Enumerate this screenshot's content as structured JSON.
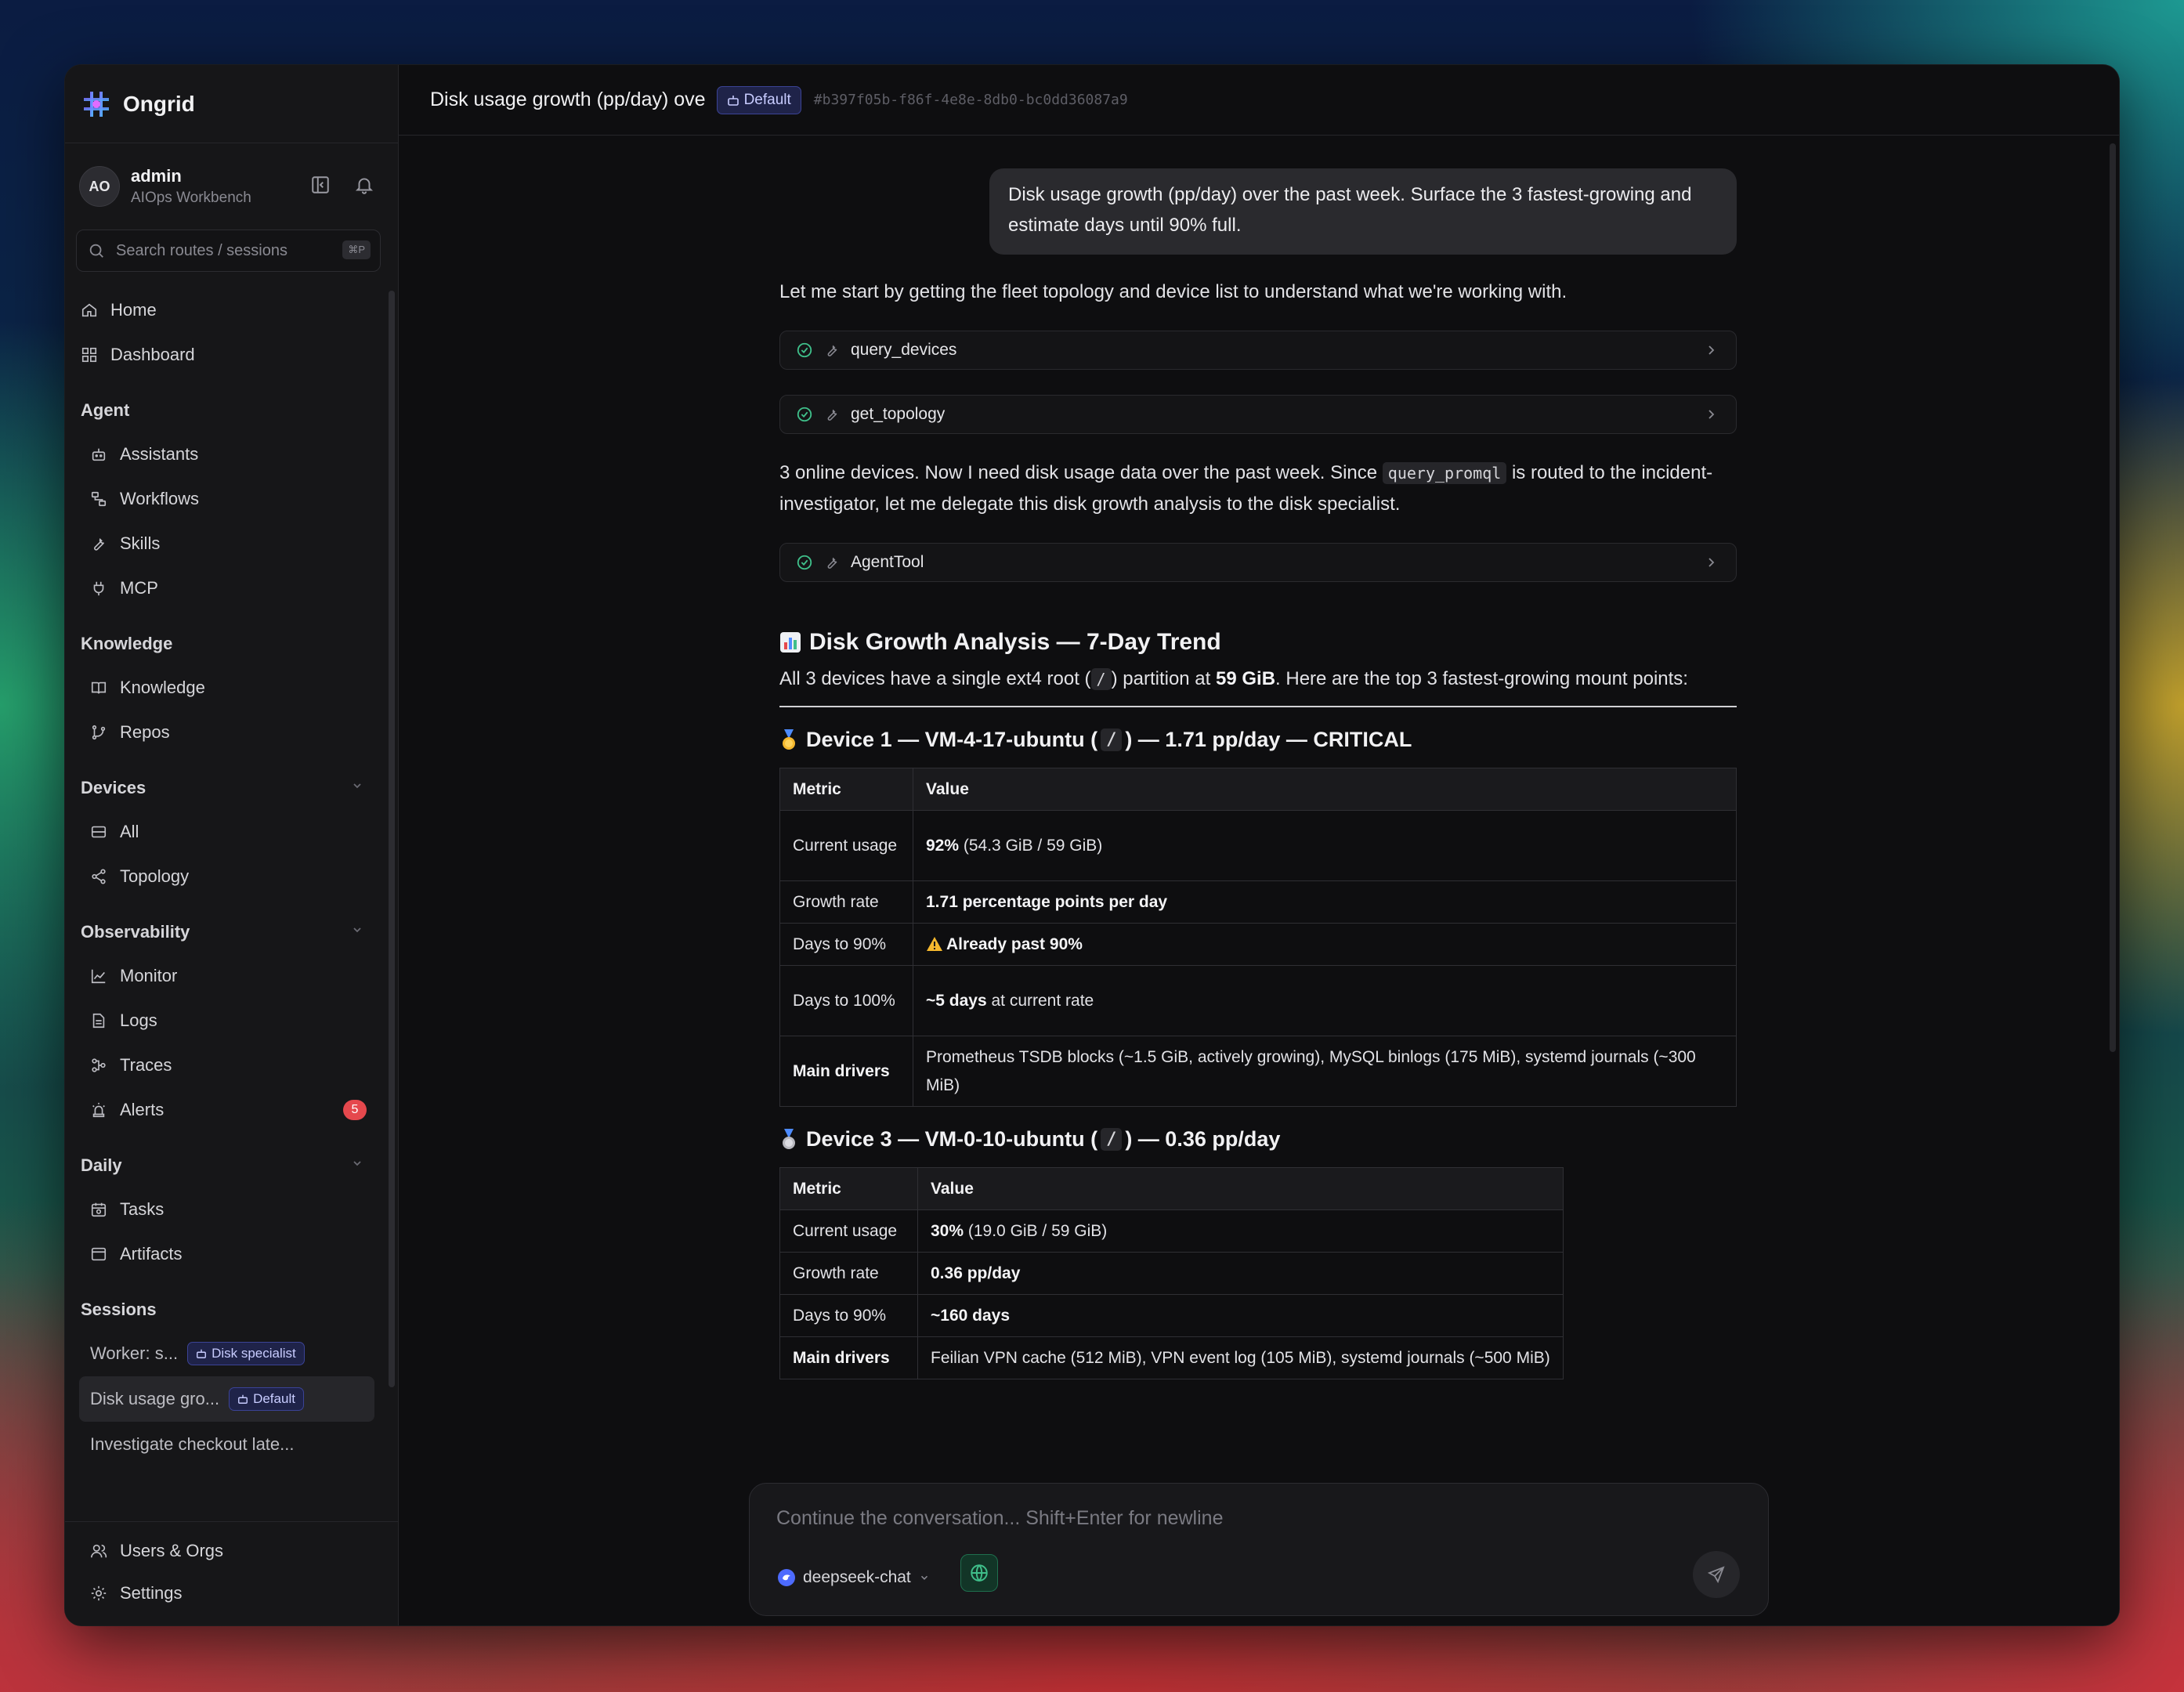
{
  "app": {
    "name": "Ongrid"
  },
  "user": {
    "initials": "AO",
    "name": "admin",
    "subtitle": "AIOps Workbench"
  },
  "search": {
    "placeholder": "Search routes / sessions",
    "shortcut": "⌘P"
  },
  "nav": {
    "home": "Home",
    "dashboard": "Dashboard",
    "agent_title": "Agent",
    "assistants": "Assistants",
    "workflows": "Workflows",
    "skills": "Skills",
    "mcp": "MCP",
    "knowledge_title": "Knowledge",
    "knowledge": "Knowledge",
    "repos": "Repos",
    "devices_title": "Devices",
    "all": "All",
    "topology": "Topology",
    "observability_title": "Observability",
    "monitor": "Monitor",
    "logs": "Logs",
    "traces": "Traces",
    "alerts": "Alerts",
    "alerts_count": "5",
    "daily_title": "Daily",
    "tasks": "Tasks",
    "artifacts": "Artifacts",
    "sessions_title": "Sessions",
    "users_orgs": "Users & Orgs",
    "settings": "Settings"
  },
  "sessions": [
    {
      "label": "Worker: s...",
      "tag": "Disk specialist"
    },
    {
      "label": "Disk usage gro...",
      "tag": "Default"
    },
    {
      "label": "Investigate checkout late..."
    }
  ],
  "header": {
    "title": "Disk usage growth (pp/day) ove",
    "tag": "Default",
    "hash": "#b397f05b-f86f-4e8e-8db0-bc0dd36087a9"
  },
  "chat": {
    "user_message": "Disk usage growth (pp/day) over the past week. Surface the 3 fastest-growing and estimate days until 90% full.",
    "intro": "Let me start by getting the fleet topology and device list to understand what we're working with.",
    "tool1": "query_devices",
    "tool2": "get_topology",
    "mid_a": "3 online devices. Now I need disk usage data over the past week. Since ",
    "mid_code": "query_promql",
    "mid_b": " is routed to the incident-investigator, let me delegate this disk growth analysis to the disk specialist.",
    "tool3": "AgentTool",
    "analysis_title": "Disk Growth Analysis — 7-Day Trend",
    "summary_a": "All 3 devices have a single ext4 root (",
    "summary_code": "/",
    "summary_b": ") partition at ",
    "summary_bold": "59 GiB",
    "summary_c": ". Here are the top 3 fastest-growing mount points:",
    "device1": {
      "title_a": "Device 1 — VM-4-17-ubuntu (",
      "title_code": "/",
      "title_b": ") — 1.71 pp/day — CRITICAL",
      "col_metric": "Metric",
      "col_value": "Value",
      "r1_label": "Current usage",
      "r1_bold": "92%",
      "r1_rest": " (54.3 GiB / 59 GiB)",
      "r2_label": "Growth rate",
      "r2_bold": "1.71 percentage points per day",
      "r3_label": "Days to 90%",
      "r3_bold": "Already past 90%",
      "r4_label": "Days to 100%",
      "r4_bold": "~5 days",
      "r4_rest": " at current rate",
      "r5_label": "Main drivers",
      "r5_value": "Prometheus TSDB blocks (~1.5 GiB, actively growing), MySQL binlogs (175 MiB), systemd journals (~300 MiB)"
    },
    "device3": {
      "title_a": "Device 3 — VM-0-10-ubuntu (",
      "title_code": "/",
      "title_b": ") — 0.36 pp/day",
      "col_metric": "Metric",
      "col_value": "Value",
      "r1_label": "Current usage",
      "r1_bold": "30%",
      "r1_rest": " (19.0 GiB / 59 GiB)",
      "r2_label": "Growth rate",
      "r2_bold": "0.36 pp/day",
      "r3_label": "Days to 90%",
      "r3_bold": "~160 days",
      "r4_label": "Main drivers",
      "r4_value": "Feilian VPN cache (512 MiB), VPN event log (105 MiB), systemd journals (~500 MiB)"
    }
  },
  "composer": {
    "placeholder": "Continue the conversation... Shift+Enter for newline",
    "model": "deepseek-chat"
  },
  "colors": {
    "accent_tag_bg": "#1f2349",
    "accent_tag_border": "#3b4396",
    "success": "#3fbf8a",
    "alert_badge": "#e5484d",
    "model_dot": "#4d6bfe"
  }
}
